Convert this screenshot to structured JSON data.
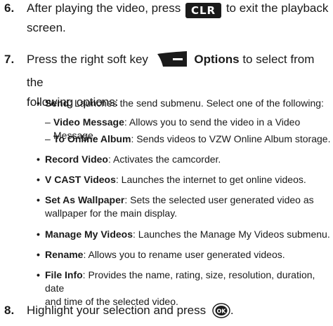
{
  "step6": {
    "number": "6.",
    "text_before": "After playing the video, press",
    "key_label": "CLR",
    "text_after": "to exit the playback",
    "text_line2": "screen."
  },
  "step7": {
    "number": "7.",
    "text_before": "Press the right soft key",
    "options_label": "Options",
    "text_after": "to select from the",
    "text_line2": "following options:"
  },
  "options": {
    "send": {
      "label": "Send",
      "desc": ": Launches the send submenu. Select one of the following:"
    },
    "send_sub": [
      {
        "label": "Video Message",
        "desc": ": Allows you to send the video in a Video Message."
      },
      {
        "label": "To Online Album",
        "desc": ": Sends videos to VZW Online Album storage."
      }
    ],
    "record_video": {
      "label": "Record Video",
      "desc": ": Activates the camcorder."
    },
    "vcast_videos": {
      "label": "V CAST Videos",
      "desc": ": Launches the internet to get online videos."
    },
    "set_as_wallpaper": {
      "label": "Set As Wallpaper",
      "desc": ": Sets the selected user generated video as",
      "desc_line2": "wallpaper for the main display."
    },
    "manage_my_videos": {
      "label": "Manage My Videos",
      "desc": ": Launches the Manage My Videos submenu."
    },
    "rename": {
      "label": "Rename",
      "desc": ": Allows you to rename user generated videos."
    },
    "file_info": {
      "label": "File Info",
      "desc": ": Provides the name, rating, size, resolution, duration, date",
      "desc_line2": "and time of the selected video."
    }
  },
  "step8": {
    "number": "8.",
    "text": "Highlight your selection and press",
    "key_label": "OK",
    "text_after": "."
  },
  "colors": {
    "text": "#1a1a1a",
    "key_background": "#1b1b1b",
    "key_text": "#ffffff"
  }
}
